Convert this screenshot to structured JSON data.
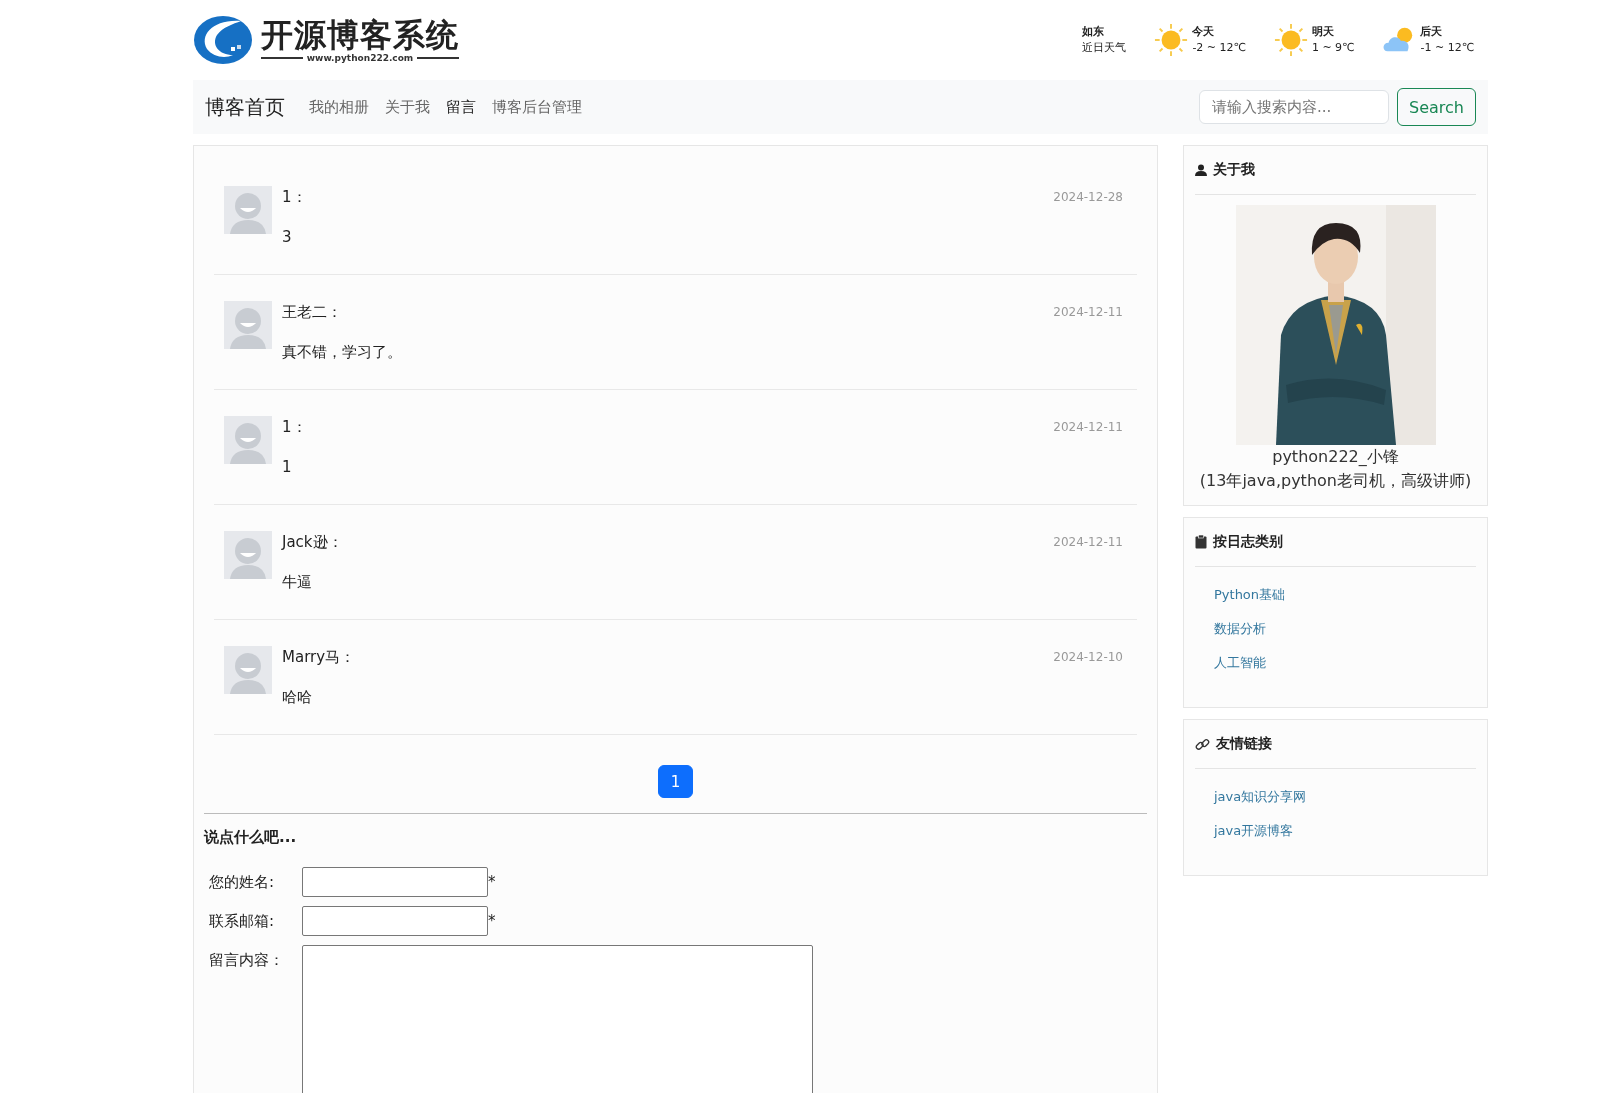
{
  "logo": {
    "title": "开源博客系统",
    "url": "www.python222.com"
  },
  "weather": {
    "city": "如东",
    "caption": "近日天气",
    "days": [
      {
        "label": "今天",
        "range": "-2 ~ 12℃",
        "kind": "sun"
      },
      {
        "label": "明天",
        "range": "1 ~ 9℃",
        "kind": "sun"
      },
      {
        "label": "后天",
        "range": "-1 ~ 12℃",
        "kind": "cloud"
      }
    ]
  },
  "nav": {
    "brand": "博客首页",
    "items": [
      {
        "label": "我的相册",
        "selected": false
      },
      {
        "label": "关于我",
        "selected": false
      },
      {
        "label": "留言",
        "selected": true
      },
      {
        "label": "博客后台管理",
        "selected": false
      }
    ],
    "search": {
      "placeholder": "请输入搜索内容...",
      "button": "Search"
    }
  },
  "comments": [
    {
      "name": "1：",
      "text": "3",
      "date": "2024-12-28"
    },
    {
      "name": "王老二：",
      "text": "真不错，学习了。",
      "date": "2024-12-11"
    },
    {
      "name": "1：",
      "text": "1",
      "date": "2024-12-11"
    },
    {
      "name": "Jack逊：",
      "text": "牛逼",
      "date": "2024-12-11"
    },
    {
      "name": "Marry马：",
      "text": "哈哈",
      "date": "2024-12-10"
    }
  ],
  "pagination": [
    {
      "label": "1",
      "selected": true
    }
  ],
  "form": {
    "title": "说点什么吧...",
    "fields": [
      {
        "label": "您的姓名:",
        "kind": "input",
        "required": "*"
      },
      {
        "label": "联系邮箱:",
        "kind": "input",
        "required": "*"
      },
      {
        "label": "留言内容：",
        "kind": "textarea"
      }
    ]
  },
  "sidebar": {
    "about": {
      "title": "关于我",
      "name": "python222_小锋",
      "bio": "(13年java,python老司机，高级讲师)"
    },
    "categories": {
      "title": "按日志类别",
      "items": [
        "Python基础",
        "数据分析",
        "人工智能"
      ]
    },
    "links": {
      "title": "友情链接",
      "items": [
        "java知识分享网",
        "java开源博客"
      ]
    }
  }
}
